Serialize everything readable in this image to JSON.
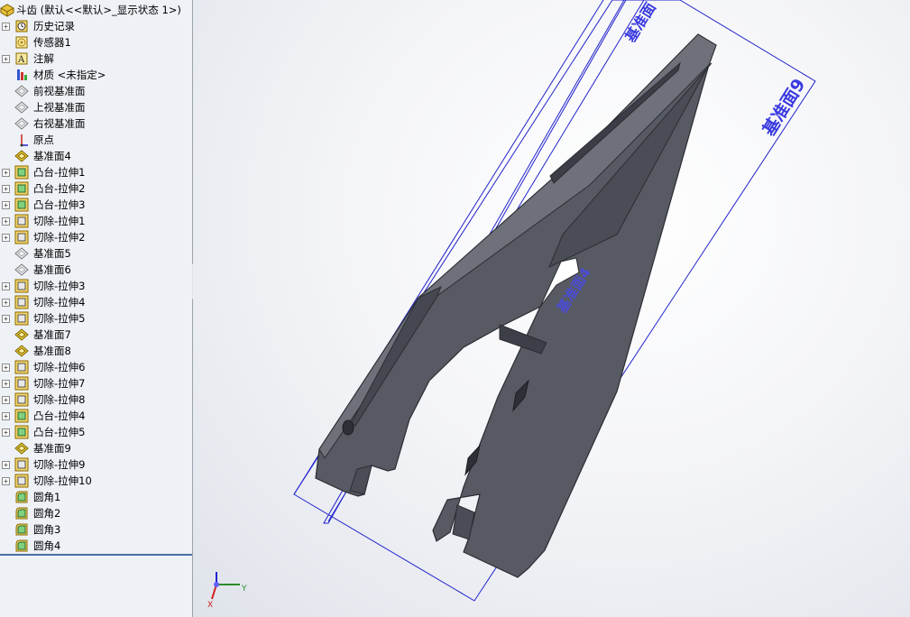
{
  "tree": {
    "root": {
      "label": "斗齿 (默认<<默认>_显示状态 1>)",
      "icon": "part-icon"
    },
    "items": [
      {
        "label": "历史记录",
        "icon": "history-icon",
        "expandable": true
      },
      {
        "label": "传感器1",
        "icon": "sensor-icon",
        "expandable": false
      },
      {
        "label": "注解",
        "icon": "annotation-icon",
        "expandable": true
      },
      {
        "label": "材质 <未指定>",
        "icon": "material-icon",
        "expandable": false
      },
      {
        "label": "前视基准面",
        "icon": "plane-icon",
        "expandable": false
      },
      {
        "label": "上视基准面",
        "icon": "plane-icon",
        "expandable": false
      },
      {
        "label": "右视基准面",
        "icon": "plane-icon",
        "expandable": false
      },
      {
        "label": "原点",
        "icon": "origin-icon",
        "expandable": false
      },
      {
        "label": "基准面4",
        "icon": "plane-yellow-icon",
        "expandable": false
      },
      {
        "label": "凸台-拉伸1",
        "icon": "boss-extrude-icon",
        "expandable": true
      },
      {
        "label": "凸台-拉伸2",
        "icon": "boss-extrude-icon",
        "expandable": true
      },
      {
        "label": "凸台-拉伸3",
        "icon": "boss-extrude-icon",
        "expandable": true
      },
      {
        "label": "切除-拉伸1",
        "icon": "cut-extrude-icon",
        "expandable": true
      },
      {
        "label": "切除-拉伸2",
        "icon": "cut-extrude-icon",
        "expandable": true
      },
      {
        "label": "基准面5",
        "icon": "plane-icon",
        "expandable": false
      },
      {
        "label": "基准面6",
        "icon": "plane-icon",
        "expandable": false
      },
      {
        "label": "切除-拉伸3",
        "icon": "cut-extrude-icon",
        "expandable": true
      },
      {
        "label": "切除-拉伸4",
        "icon": "cut-extrude-icon",
        "expandable": true
      },
      {
        "label": "切除-拉伸5",
        "icon": "cut-extrude-icon",
        "expandable": true
      },
      {
        "label": "基准面7",
        "icon": "plane-yellow-icon",
        "expandable": false
      },
      {
        "label": "基准面8",
        "icon": "plane-yellow-icon",
        "expandable": false
      },
      {
        "label": "切除-拉伸6",
        "icon": "cut-extrude-icon",
        "expandable": true
      },
      {
        "label": "切除-拉伸7",
        "icon": "cut-extrude-icon",
        "expandable": true
      },
      {
        "label": "切除-拉伸8",
        "icon": "cut-extrude-icon",
        "expandable": true
      },
      {
        "label": "凸台-拉伸4",
        "icon": "boss-extrude-icon",
        "expandable": true
      },
      {
        "label": "凸台-拉伸5",
        "icon": "boss-extrude-icon",
        "expandable": true
      },
      {
        "label": "基准面9",
        "icon": "plane-yellow-icon",
        "expandable": false
      },
      {
        "label": "切除-拉伸9",
        "icon": "cut-extrude-icon",
        "expandable": true
      },
      {
        "label": "切除-拉伸10",
        "icon": "cut-extrude-icon",
        "expandable": true
      },
      {
        "label": "圆角1",
        "icon": "fillet-icon",
        "expandable": false
      },
      {
        "label": "圆角2",
        "icon": "fillet-icon",
        "expandable": false
      },
      {
        "label": "圆角3",
        "icon": "fillet-icon",
        "expandable": false
      },
      {
        "label": "圆角4",
        "icon": "fillet-icon",
        "expandable": false
      }
    ]
  },
  "viewport": {
    "plane_labels": {
      "plane9": "基准面9",
      "plane_top": "基准面",
      "plane_inner": "基准面4"
    },
    "triad": {
      "x": "X",
      "y": "Y"
    },
    "colors": {
      "part": "#575a63",
      "part_edge": "#2b2d33",
      "plane": "#2222cc",
      "plane_text": "#3a3ae0"
    }
  }
}
